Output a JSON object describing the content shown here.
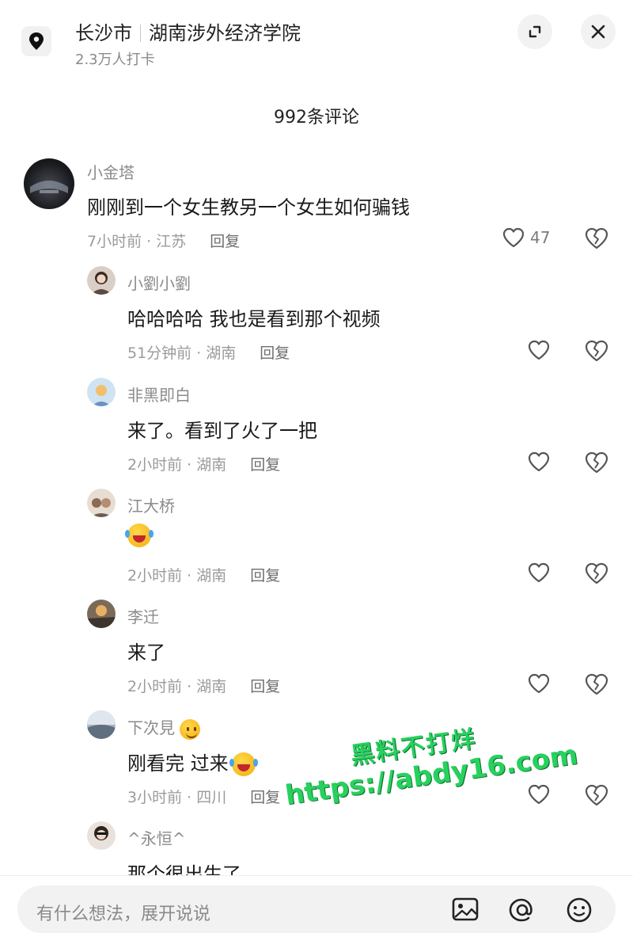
{
  "header": {
    "city": "长沙市",
    "place": "湖南涉外经济学院",
    "checkins": "2.3万人打卡"
  },
  "comments_title": "992条评论",
  "comments": [
    {
      "nick": "小金塔",
      "text": "刚刚到一个女生教另一个女生如何骗钱",
      "meta": "7小时前 · 江苏",
      "reply": "回复",
      "likes": "47"
    },
    {
      "nick": "小劉小劉",
      "text": "哈哈哈哈 我也是看到那个视频",
      "meta": "51分钟前 · 湖南",
      "reply": "回复"
    },
    {
      "nick": "非黑即白",
      "text": "来了。看到了火了一把",
      "meta": "2小时前 · 湖南",
      "reply": "回复"
    },
    {
      "nick": "江大桥",
      "text": "",
      "meta": "2小时前 · 湖南",
      "reply": "回复"
    },
    {
      "nick": "李迁",
      "text": "来了",
      "meta": "2小时前 · 湖南",
      "reply": "回复"
    },
    {
      "nick": "下次見",
      "text": "刚看完 过来",
      "meta": "3小时前 · 四川",
      "reply": "回复"
    },
    {
      "nick": "^永恒^",
      "text": "那个很出生了"
    }
  ],
  "watermark": {
    "line1": "黑料不打烊",
    "line2": "https://abdy16.com"
  },
  "input": {
    "placeholder": "有什么想法，展开说说"
  },
  "icons": {
    "location": "location-pin-icon",
    "expand": "expand-icon",
    "close": "close-icon",
    "like": "heart-icon",
    "dislike": "broken-heart-icon",
    "image": "image-icon",
    "mention": "at-icon",
    "emoji": "emoji-icon"
  }
}
